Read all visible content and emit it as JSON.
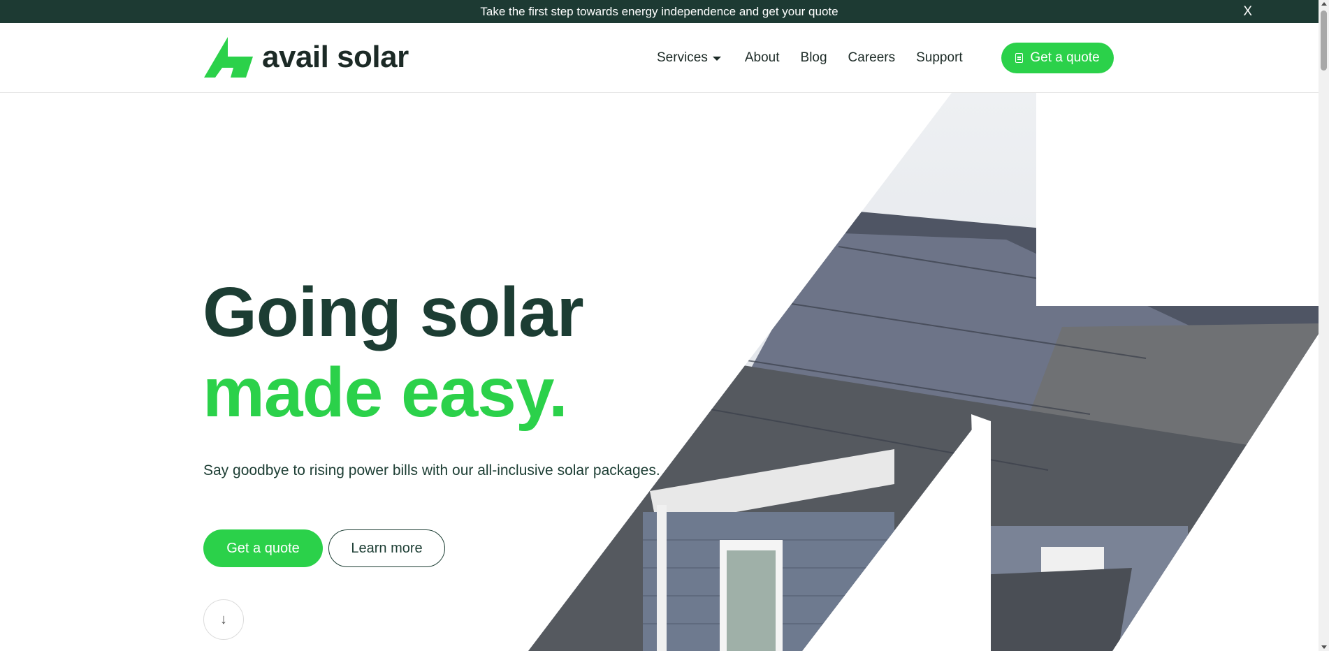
{
  "announcement": {
    "text": "Take the first step towards energy independence and get your quote",
    "close_label": "X"
  },
  "brand": {
    "name": "avail solar",
    "logo_icon": "lightning-bolt-icon"
  },
  "nav": {
    "items": [
      {
        "label": "Services",
        "has_dropdown": true
      },
      {
        "label": "About"
      },
      {
        "label": "Blog"
      },
      {
        "label": "Careers"
      },
      {
        "label": "Support"
      }
    ],
    "cta_label": "Get a quote",
    "cta_icon": "document-icon"
  },
  "hero": {
    "title_line1": "Going solar",
    "title_line2": "made easy.",
    "subtitle": "Say goodbye to rising power bills with our all-inclusive solar packages.",
    "primary_button": "Get a quote",
    "secondary_button": "Learn more",
    "scroll_icon": "arrow-down-icon",
    "scroll_glyph": "↓"
  },
  "colors": {
    "brand_green": "#2bd14a",
    "dark_green": "#1c3d33",
    "announce_bg": "#1d3a33"
  }
}
